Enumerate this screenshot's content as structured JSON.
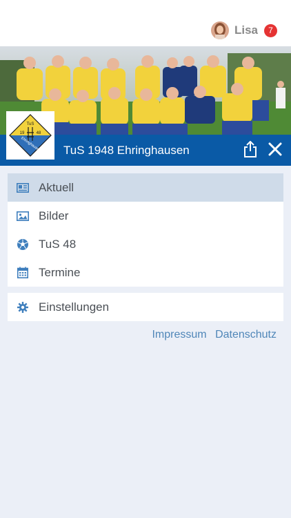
{
  "header": {
    "user_name": "Lisa",
    "badge_count": "7"
  },
  "club": {
    "name": "TuS 1948 Ehringhausen",
    "logo_text": {
      "top": "TuS",
      "year_left": "19",
      "year_right": "48",
      "bottom": "Ehringhausen"
    }
  },
  "menu": {
    "items": [
      {
        "label": "Aktuell",
        "icon": "newspaper-icon",
        "active": true
      },
      {
        "label": "Bilder",
        "icon": "image-icon",
        "active": false
      },
      {
        "label": "TuS 48",
        "icon": "soccer-ball-icon",
        "active": false
      },
      {
        "label": "Termine",
        "icon": "calendar-icon",
        "active": false
      }
    ],
    "settings_label": "Einstellungen"
  },
  "footer": {
    "impressum": "Impressum",
    "datenschutz": "Datenschutz"
  },
  "colors": {
    "brand_blue": "#0a5aa6",
    "active_item_bg": "#cfdbe9",
    "badge_red": "#e53333",
    "icon_blue": "#3f7fbd",
    "page_bg": "#ebeff7"
  }
}
